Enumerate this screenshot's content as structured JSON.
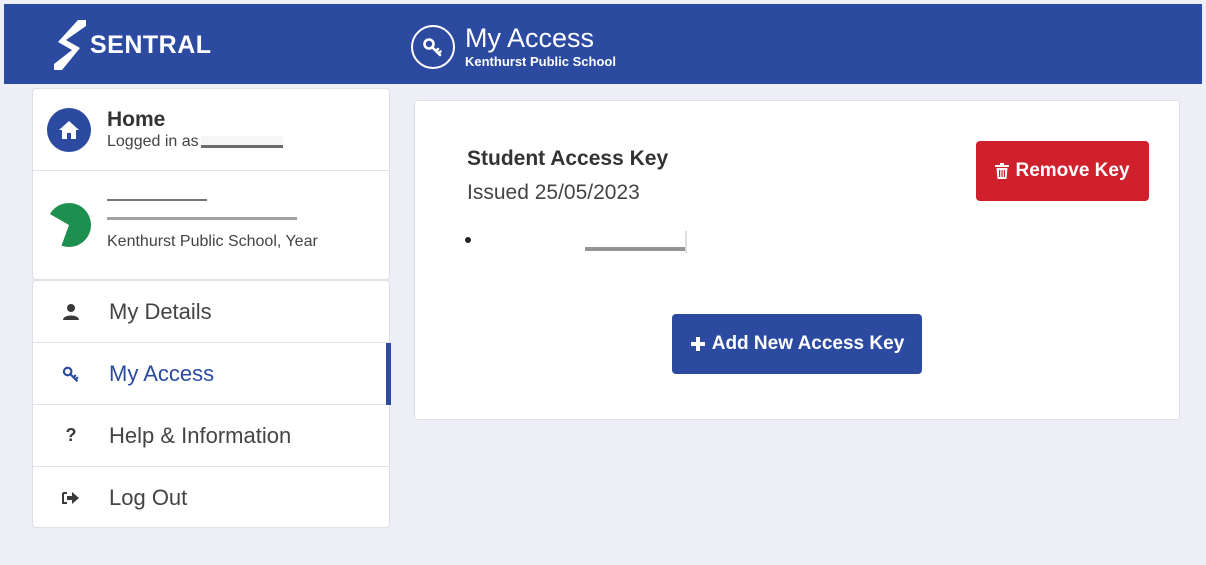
{
  "colors": {
    "brand_blue": "#2b4aa0",
    "danger_red": "#d0202c",
    "page_bg": "#eeeef6"
  },
  "header": {
    "brand": "SENTRAL",
    "title": "My Access",
    "subtitle": "Kenthurst Public School",
    "title_icon": "key-icon"
  },
  "profile": {
    "home_title": "Home",
    "logged_in_prefix": "Logged in as",
    "student_school": "Kenthurst Public School, Year"
  },
  "nav": {
    "items": [
      {
        "label": "My Details",
        "icon": "user-icon"
      },
      {
        "label": "My Access",
        "icon": "key-icon",
        "active": true
      },
      {
        "label": "Help & Information",
        "icon": "question-icon"
      },
      {
        "label": "Log Out",
        "icon": "sign-out-icon"
      }
    ]
  },
  "main": {
    "key_title": "Student Access Key",
    "key_issued": "Issued 25/05/2023",
    "remove_label": "Remove Key",
    "add_label": "Add New Access Key"
  }
}
